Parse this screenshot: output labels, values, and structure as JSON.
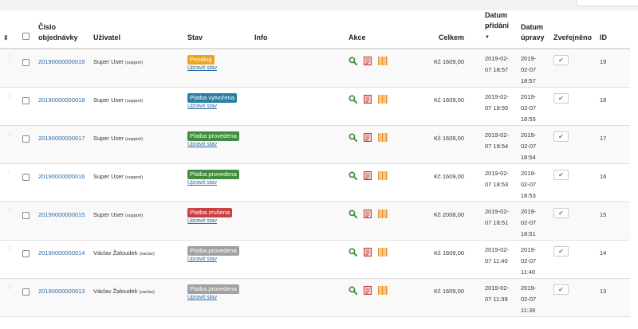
{
  "header": {
    "sort": "⇕",
    "order_number": "Číslo objednávky",
    "user": "Uživatel",
    "status": "Stav",
    "info": "Info",
    "actions": "Akce",
    "total": "Celkem",
    "date_added": "Datum přidání",
    "date_added_sort": "▼",
    "date_modified": "Datum úpravy",
    "published": "Zveřejněno",
    "id": "ID"
  },
  "edit_status_label": "Upravit stav",
  "status_colors": {
    "Pending": "#f0a31f",
    "Platba vytvořena": "#2b7fa3",
    "Platba provedena green": "#3f8d3e",
    "Platba zrušena": "#c9403f",
    "Platba provedena gray": "#a1a1a1"
  },
  "icons": [
    "search-icon",
    "document-icon",
    "barcode-icon",
    "checkmark-icon",
    "drag-handle-icon"
  ],
  "rows": [
    {
      "order": "20190000000019",
      "user": "Super User",
      "username": "(support)",
      "status": "Pending",
      "status_color": "#f0a31f",
      "total": "Kč 1609,00",
      "added_date": "2019-02-",
      "added_time": "07 18:57",
      "mod_a": "2019-",
      "mod_b": "02-07",
      "mod_c": "18:57",
      "id": "19"
    },
    {
      "order": "20190000000018",
      "user": "Super User",
      "username": "(support)",
      "status": "Platba vytvořena",
      "status_color": "#2b7fa3",
      "total": "Kč 1609,00",
      "added_date": "2019-02-",
      "added_time": "07 18:55",
      "mod_a": "2019-",
      "mod_b": "02-07",
      "mod_c": "18:55",
      "id": "18"
    },
    {
      "order": "20190000000017",
      "user": "Super User",
      "username": "(support)",
      "status": "Platba provedena",
      "status_color": "#3f8d3e",
      "total": "Kč 1609,00",
      "added_date": "2019-02-",
      "added_time": "07 18:54",
      "mod_a": "2019-",
      "mod_b": "02-07",
      "mod_c": "18:54",
      "id": "17"
    },
    {
      "order": "20190000000016",
      "user": "Super User",
      "username": "(support)",
      "status": "Platba provedena",
      "status_color": "#3f8d3e",
      "total": "Kč 1609,00",
      "added_date": "2019-02-",
      "added_time": "07 18:53",
      "mod_a": "2019-",
      "mod_b": "02-07",
      "mod_c": "18:53",
      "id": "16"
    },
    {
      "order": "20190000000015",
      "user": "Super User",
      "username": "(support)",
      "status": "Platba zrušena",
      "status_color": "#c9403f",
      "total": "Kč 2008,00",
      "added_date": "2019-02-",
      "added_time": "07 18:51",
      "mod_a": "2019-",
      "mod_b": "02-07",
      "mod_c": "18:51",
      "id": "15"
    },
    {
      "order": "20190000000014",
      "user": "Václav Žaloudek",
      "username": "(vaclav)",
      "status": "Platba provedena",
      "status_color": "#a1a1a1",
      "total": "Kč 1609,00",
      "added_date": "2019-02-",
      "added_time": "07 11:40",
      "mod_a": "2019-",
      "mod_b": "02-07",
      "mod_c": "11:40",
      "id": "14"
    },
    {
      "order": "20190000000013",
      "user": "Václav Žaloudek",
      "username": "(vaclav)",
      "status": "Platba provedena",
      "status_color": "#a1a1a1",
      "total": "Kč 1609,00",
      "added_date": "2019-02-",
      "added_time": "07 11:39",
      "mod_a": "2019-",
      "mod_b": "02-07",
      "mod_c": "11:39",
      "id": "13"
    }
  ]
}
